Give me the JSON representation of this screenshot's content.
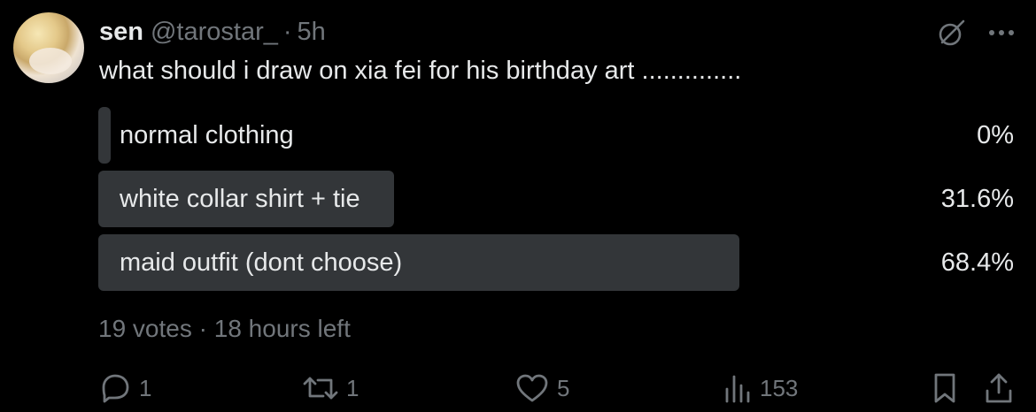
{
  "post": {
    "author_name": "sen",
    "handle": "@tarostar_",
    "separator": "·",
    "time": "5h",
    "text": "what should i draw on xia fei for his birthday art .............."
  },
  "top_icons": [
    "grok-icon",
    "more-icon"
  ],
  "poll": {
    "options": [
      {
        "label": "normal clothing",
        "percent_text": "0%",
        "percent": 0
      },
      {
        "label": "white collar shirt + tie",
        "percent_text": "31.6%",
        "percent": 31.6
      },
      {
        "label": "maid outfit (dont choose)",
        "percent_text": "68.4%",
        "percent": 68.4
      }
    ],
    "votes": "19 votes",
    "meta_separator": "·",
    "time_left": "18 hours left"
  },
  "actions": {
    "replies": "1",
    "reposts": "1",
    "likes": "5",
    "views": "153"
  },
  "colors": {
    "background": "#000000",
    "text": "#e7e9ea",
    "muted": "#71767b",
    "poll_bar": "#333639"
  }
}
